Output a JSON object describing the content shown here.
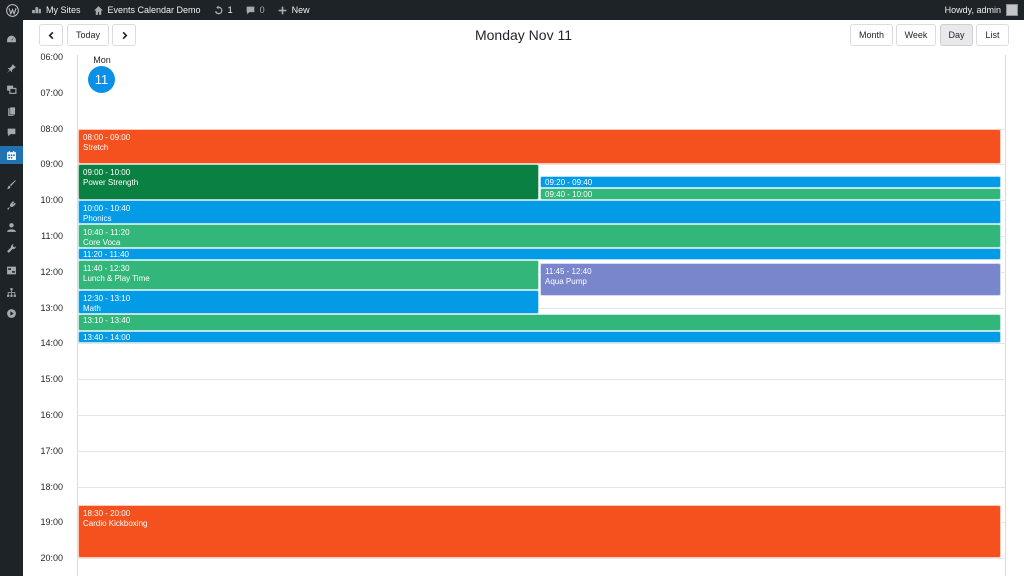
{
  "adminbar": {
    "my_sites": "My Sites",
    "site_name": "Events Calendar Demo",
    "updates_count": "1",
    "comments_count": "0",
    "new_label": "New",
    "greeting": "Howdy, admin"
  },
  "toolbar": {
    "today_label": "Today",
    "title": "Monday Nov 11",
    "views": [
      "Month",
      "Week",
      "Day",
      "List"
    ],
    "active_view": "Day"
  },
  "day_header": {
    "weekday": "Mon",
    "day_number": "11"
  },
  "hours": [
    "06:00",
    "07:00",
    "08:00",
    "09:00",
    "10:00",
    "11:00",
    "12:00",
    "13:00",
    "14:00",
    "15:00",
    "16:00",
    "17:00",
    "18:00",
    "19:00",
    "20:00"
  ],
  "events": [
    {
      "time": "08:00 - 09:00",
      "title": "Stretch",
      "color": "#f4511e",
      "start": "08:00",
      "end": "09:00",
      "column": 0,
      "columns": 1
    },
    {
      "time": "09:00 - 10:00",
      "title": "Power Strength",
      "color": "#0b8043",
      "start": "09:00",
      "end": "10:00",
      "column": 0,
      "columns": 2
    },
    {
      "time": "09:20 - 09:40",
      "title": "",
      "color": "#039be5",
      "start": "09:20",
      "end": "09:40",
      "column": 1,
      "columns": 2
    },
    {
      "time": "09:40 - 10:00",
      "title": "",
      "color": "#33b679",
      "start": "09:40",
      "end": "10:00",
      "column": 1,
      "columns": 2
    },
    {
      "time": "10:00 - 10:40",
      "title": "Phonics",
      "color": "#039be5",
      "start": "10:00",
      "end": "10:40",
      "column": 0,
      "columns": 1
    },
    {
      "time": "10:40 - 11:20",
      "title": "Core Voca",
      "color": "#33b679",
      "start": "10:40",
      "end": "11:20",
      "column": 0,
      "columns": 1
    },
    {
      "time": "11:20 - 11:40",
      "title": "",
      "color": "#039be5",
      "start": "11:20",
      "end": "11:40",
      "column": 0,
      "columns": 1
    },
    {
      "time": "11:40 - 12:30",
      "title": "Lunch & Play Time",
      "color": "#33b679",
      "start": "11:40",
      "end": "12:30",
      "column": 0,
      "columns": 2
    },
    {
      "time": "11:45 - 12:40",
      "title": "Aqua Pump",
      "color": "#7986cb",
      "start": "11:45",
      "end": "12:40",
      "column": 1,
      "columns": 2
    },
    {
      "time": "12:30 - 13:10",
      "title": "Math",
      "color": "#039be5",
      "start": "12:30",
      "end": "13:10",
      "column": 0,
      "columns": 2
    },
    {
      "time": "13:10 - 13:40",
      "title": "",
      "color": "#33b679",
      "start": "13:10",
      "end": "13:40",
      "column": 0,
      "columns": 1
    },
    {
      "time": "13:40 - 14:00",
      "title": "",
      "color": "#039be5",
      "start": "13:40",
      "end": "14:00",
      "column": 0,
      "columns": 1
    },
    {
      "time": "18:30 - 20:00",
      "title": "Cardio Kickboxing",
      "color": "#f4511e",
      "start": "18:30",
      "end": "20:00",
      "column": 0,
      "columns": 1
    }
  ],
  "colors": {
    "today_circle": "#0b90e8",
    "admin_bar": "#1d2327",
    "menu_active": "#2271b1"
  }
}
